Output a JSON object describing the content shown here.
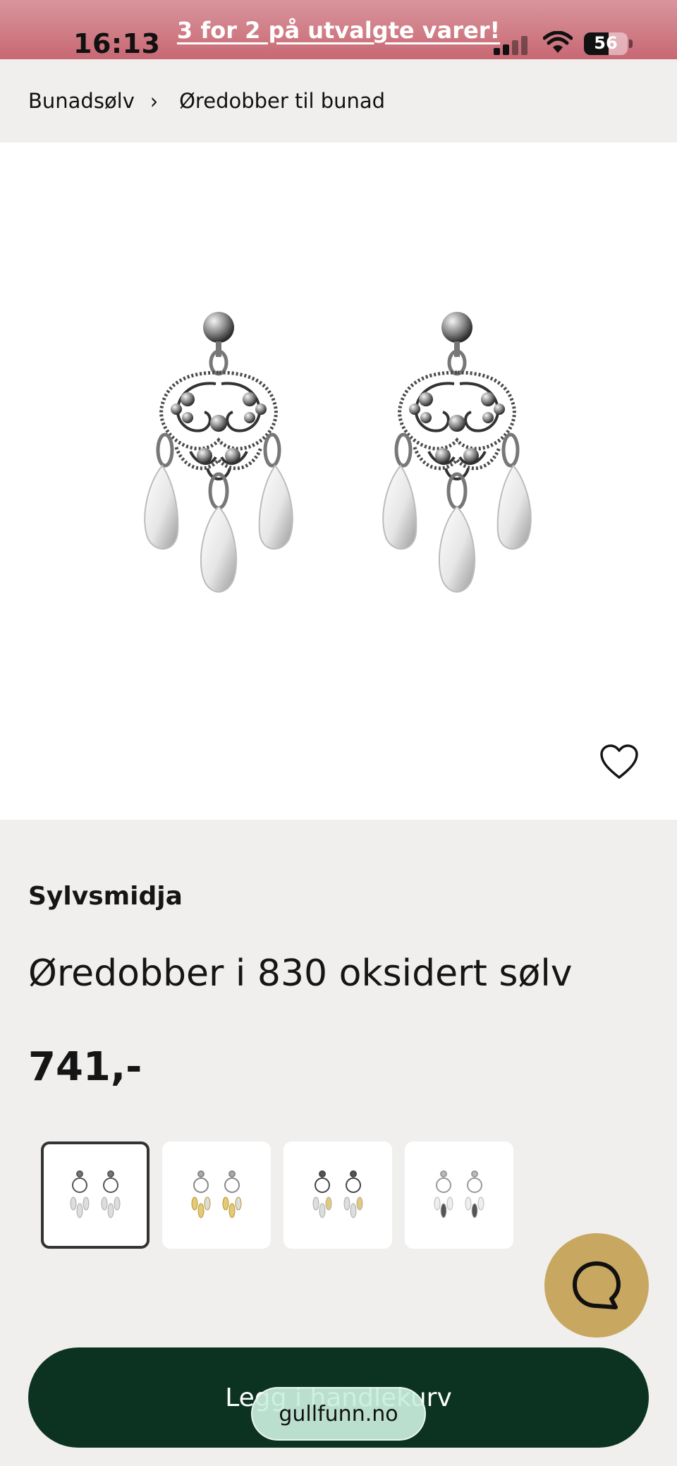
{
  "status_bar": {
    "time": "16:13",
    "promo_text": "3 for 2 på utvalgte varer!",
    "battery_level": "56",
    "battery_fraction": 0.56
  },
  "breadcrumb": {
    "items": [
      "Bunadsølv",
      "Øredobber til bunad"
    ],
    "separator": "›"
  },
  "product": {
    "brand": "Sylvsmidja",
    "title": "Øredobber i 830 oksidert sølv",
    "price": "741,-",
    "favorite_icon": "heart-outline-icon",
    "variants": [
      {
        "icon": "earring-variant-oxidized",
        "selected": true
      },
      {
        "icon": "earring-variant-gold",
        "selected": false
      },
      {
        "icon": "earring-variant-gold-accent",
        "selected": false
      },
      {
        "icon": "earring-variant-silver",
        "selected": false
      }
    ]
  },
  "actions": {
    "add_to_cart_label": "Legg i handlekurv",
    "chat_icon": "chat-bubble-icon"
  },
  "browser": {
    "url": "gullfunn.no"
  },
  "colors": {
    "status_bar": "#c86873",
    "cart_button": "#0c3321",
    "chat_button": "#c8a760",
    "page_background": "#f0efed"
  }
}
